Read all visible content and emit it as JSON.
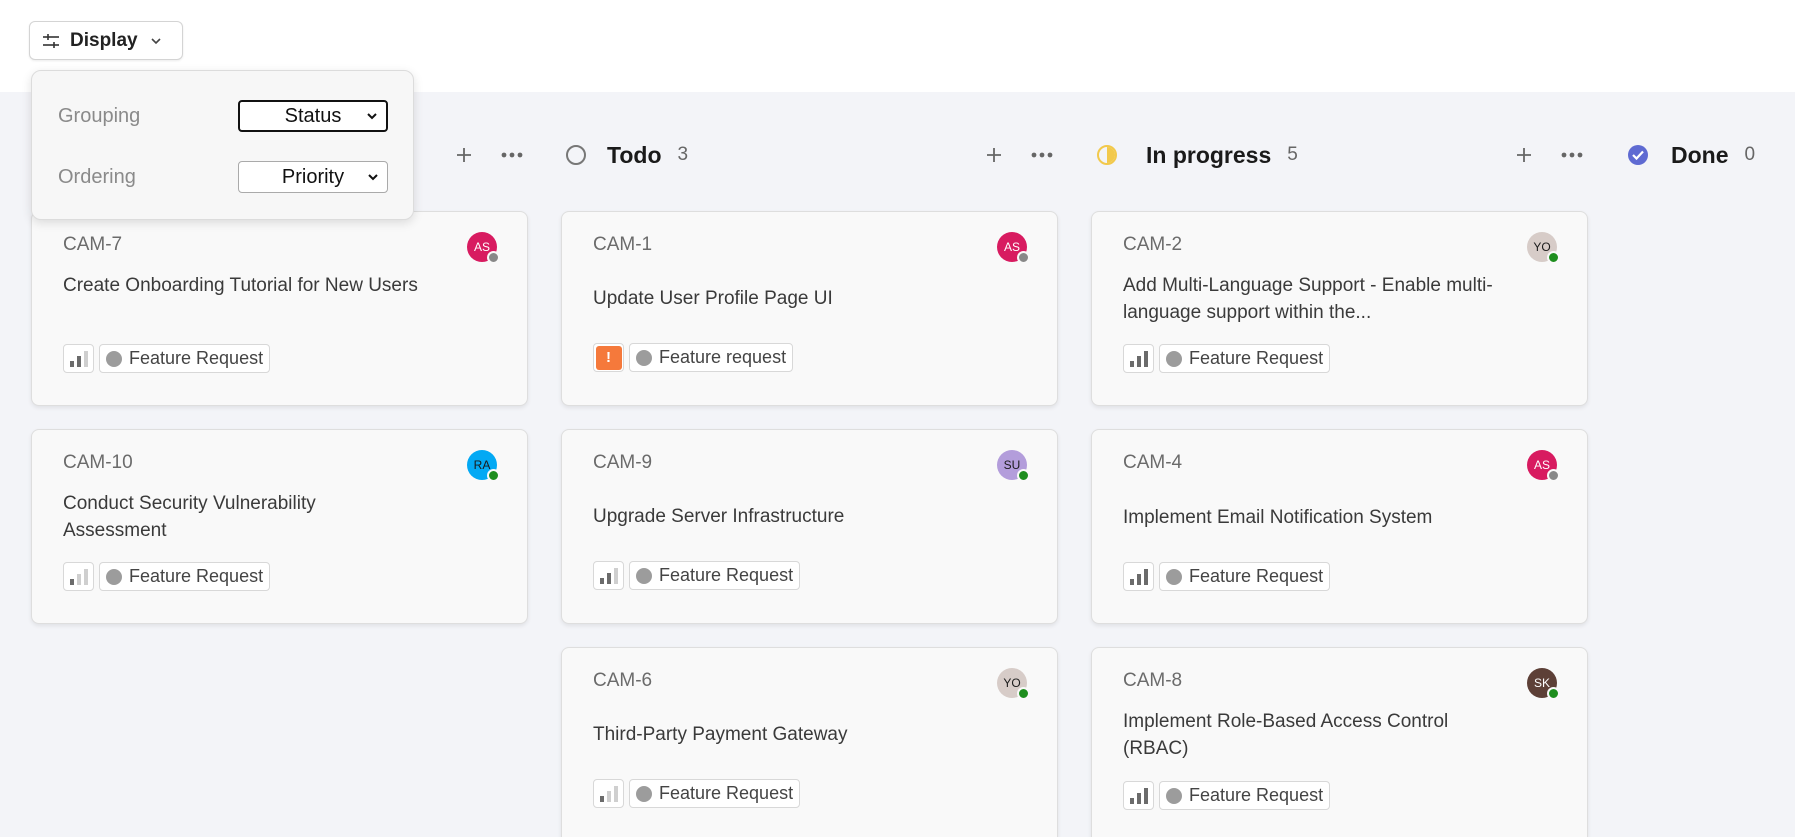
{
  "toolbar": {
    "display_label": "Display"
  },
  "display_menu": {
    "grouping_label": "Grouping",
    "grouping_value": "Status",
    "ordering_label": "Ordering",
    "ordering_value": "Priority"
  },
  "columns": [
    {
      "title": "Todo",
      "count": "3",
      "icon": "circle-outline-icon"
    },
    {
      "title": "In progress",
      "count": "5",
      "icon": "half-circle-icon"
    },
    {
      "title": "Done",
      "count": "0",
      "icon": "check-circle-icon"
    }
  ],
  "cards": {
    "backlog": [
      {
        "id": "CAM-7",
        "title": "Create Onboarding Tutorial for New Users",
        "avatar": "AS",
        "avatar_color": "#d81b60",
        "status_color": "#888888",
        "priority": "medium",
        "label": "Feature Request"
      },
      {
        "id": "CAM-10",
        "title": "Conduct Security Vulnerability Assessment",
        "avatar": "RA",
        "avatar_color": "#03a9f4",
        "status_color": "#1e8e1e",
        "priority": "low",
        "label": "Feature Request"
      }
    ],
    "todo": [
      {
        "id": "CAM-1",
        "title": "Update User Profile Page UI",
        "avatar": "AS",
        "avatar_color": "#d81b60",
        "status_color": "#888888",
        "priority": "urgent",
        "label": "Feature request"
      },
      {
        "id": "CAM-9",
        "title": "Upgrade Server Infrastructure",
        "avatar": "SU",
        "avatar_color": "#b39ddb",
        "status_color": "#1e8e1e",
        "priority": "medium",
        "label": "Feature Request"
      },
      {
        "id": "CAM-6",
        "title": "Third-Party Payment Gateway",
        "avatar": "YO",
        "avatar_color": "#d7ccc8",
        "status_color": "#1e8e1e",
        "priority": "low",
        "label": "Feature Request"
      }
    ],
    "in_progress": [
      {
        "id": "CAM-2",
        "title": "Add Multi-Language Support - Enable multi-language support within the...",
        "avatar": "YO",
        "avatar_color": "#d7ccc8",
        "status_color": "#1e8e1e",
        "priority": "high",
        "label": "Feature Request"
      },
      {
        "id": "CAM-4",
        "title": "Implement Email Notification System",
        "avatar": "AS",
        "avatar_color": "#d81b60",
        "status_color": "#888888",
        "priority": "high",
        "label": "Feature Request"
      },
      {
        "id": "CAM-8",
        "title": "Implement Role-Based Access Control (RBAC)",
        "avatar": "SK",
        "avatar_color": "#5d4037",
        "status_color": "#1e8e1e",
        "priority": "high",
        "label": "Feature Request"
      }
    ]
  }
}
